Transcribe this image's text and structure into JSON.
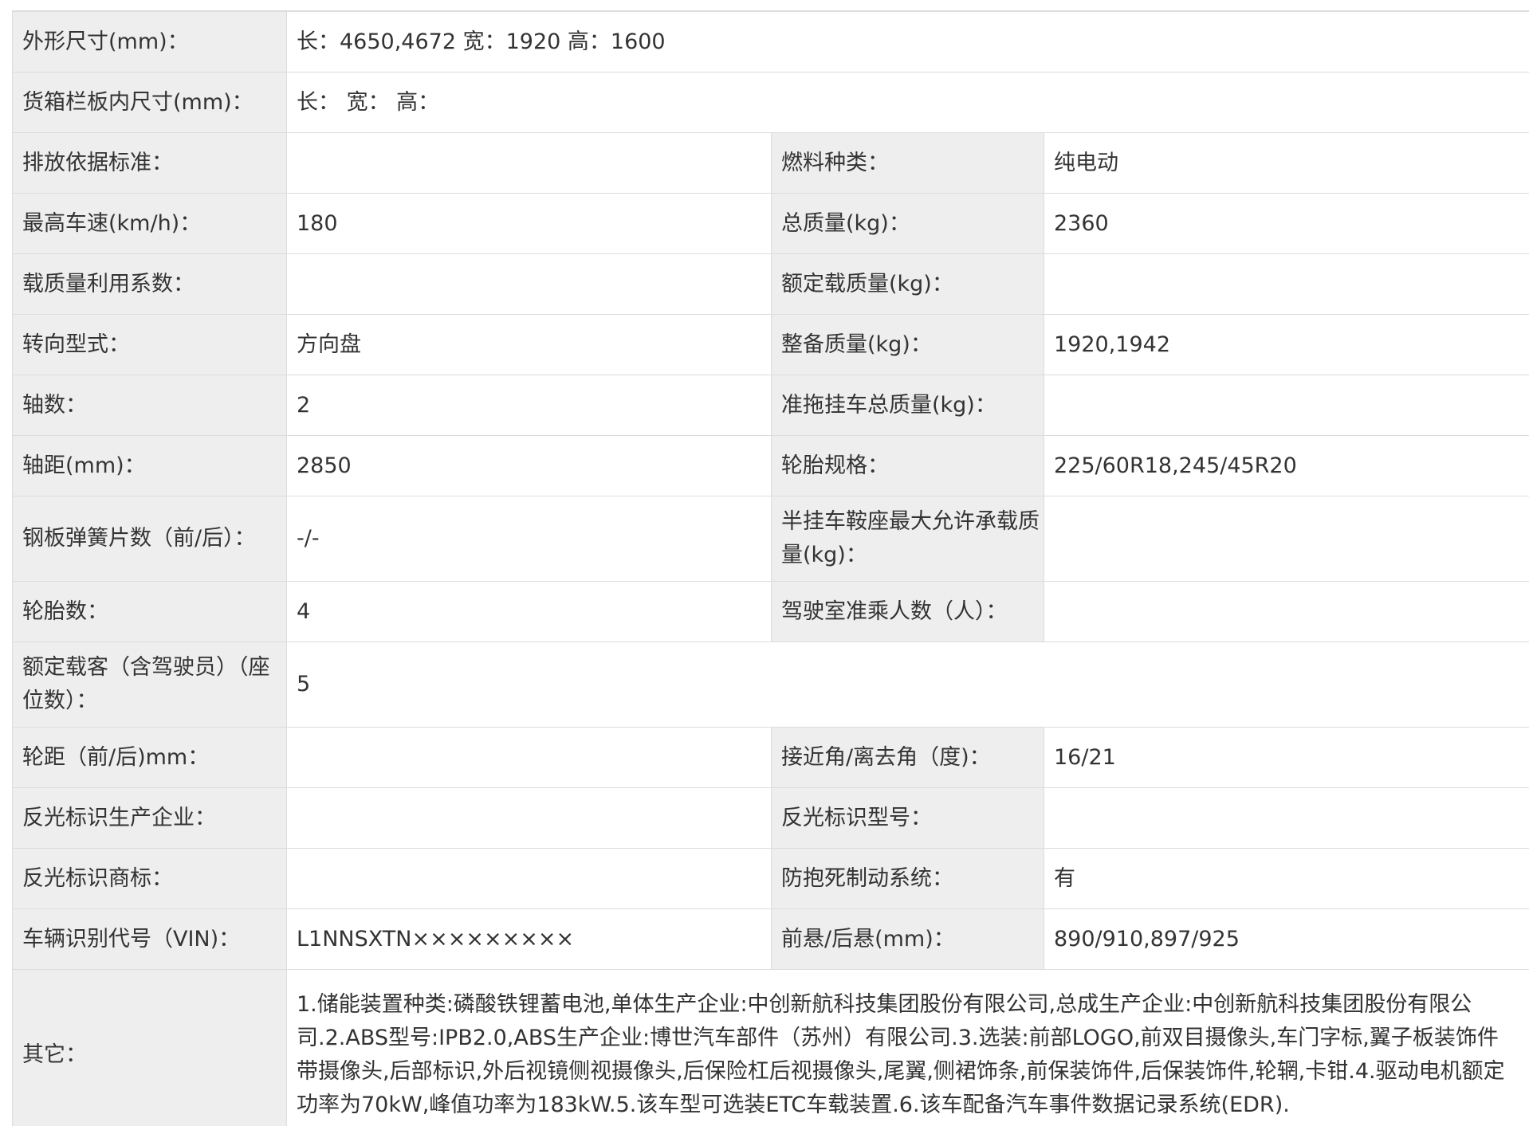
{
  "rows": [
    {
      "k1": "外形尺寸(mm)：",
      "v1": "长：4650,4672 宽：1920 高：1600"
    },
    {
      "k1": "货箱栏板内尺寸(mm)：",
      "v1": "长： 宽： 高："
    },
    {
      "k1": "排放依据标准：",
      "v1": "",
      "k2": "燃料种类：",
      "v2": "纯电动"
    },
    {
      "k1": "最高车速(km/h)：",
      "v1": "180",
      "k2": "总质量(kg)：",
      "v2": "2360"
    },
    {
      "k1": "载质量利用系数：",
      "v1": "",
      "k2": "额定载质量(kg)：",
      "v2": ""
    },
    {
      "k1": "转向型式：",
      "v1": "方向盘",
      "k2": "整备质量(kg)：",
      "v2": "1920,1942"
    },
    {
      "k1": "轴数：",
      "v1": "2",
      "k2": "准拖挂车总质量(kg)：",
      "v2": ""
    },
    {
      "k1": "轴距(mm)：",
      "v1": "2850",
      "k2": "轮胎规格：",
      "v2": "225/60R18,245/45R20"
    },
    {
      "k1": "钢板弹簧片数（前/后）：",
      "v1": "-/-",
      "k2": "半挂车鞍座最大允许承载质量(kg)：",
      "v2": ""
    },
    {
      "k1": "轮胎数：",
      "v1": "4",
      "k2": "驾驶室准乘人数（人）：",
      "v2": ""
    },
    {
      "k1": "额定载客（含驾驶员）（座位数）：",
      "v1": "5"
    },
    {
      "k1": "轮距（前/后)mm：",
      "v1": "",
      "k2": "接近角/离去角（度)：",
      "v2": "16/21"
    },
    {
      "k1": "反光标识生产企业：",
      "v1": "",
      "k2": "反光标识型号：",
      "v2": ""
    },
    {
      "k1": "反光标识商标：",
      "v1": "",
      "k2": "防抱死制动系统：",
      "v2": "有"
    },
    {
      "k1": "车辆识别代号（VIN)：",
      "v1": "L1NNSXTN×××××××××",
      "k2": "前悬/后悬(mm)：",
      "v2": "890/910,897/925"
    },
    {
      "k1": "其它：",
      "v1": "1.储能装置种类:磷酸铁锂蓄电池,单体生产企业:中创新航科技集团股份有限公司,总成生产企业:中创新航科技集团股份有限公司.2.ABS型号:IPB2.0,ABS生产企业:博世汽车部件（苏州）有限公司.3.选装:前部LOGO,前双目摄像头,车门字标,翼子板装饰件带摄像头,后部标识,外后视镜侧视摄像头,后保险杠后视摄像头,尾翼,侧裙饰条,前保装饰件,后保装饰件,轮辋,卡钳.4.驱动电机额定功率为70kW,峰值功率为183kW.5.该车型可选装ETC车载装置.6.该车配备汽车事件数据记录系统(EDR)."
    }
  ]
}
